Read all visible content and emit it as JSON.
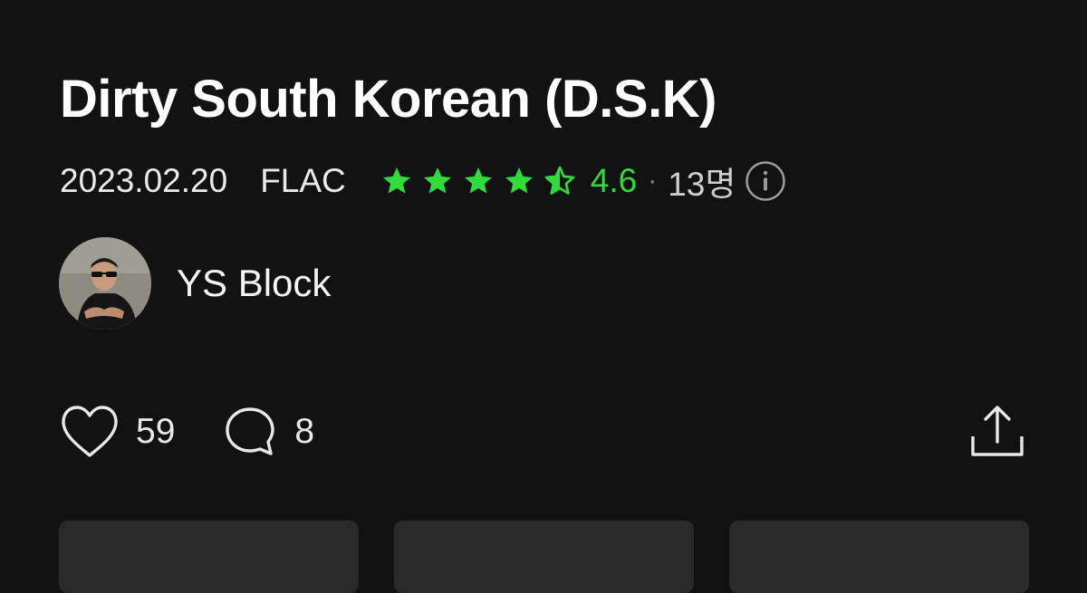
{
  "album": {
    "title": "Dirty South Korean (D.S.K)",
    "release_date": "2023.02.20",
    "format": "FLAC"
  },
  "rating": {
    "value": "4.6",
    "stars": 4.6,
    "max_stars": 5,
    "separator": "·",
    "count": "13명",
    "star_color": "#2fdc3a",
    "info_icon": "info-circle-icon"
  },
  "artist": {
    "name": "YS Block",
    "avatar": "artist-avatar-photo"
  },
  "actions": {
    "likes": "59",
    "comments": "8",
    "like_icon": "heart-icon",
    "comment_icon": "comment-bubble-icon",
    "share_icon": "share-icon"
  },
  "colors": {
    "background": "#121212",
    "accent": "#2fdc3a",
    "card_background": "#2a2a2a"
  }
}
